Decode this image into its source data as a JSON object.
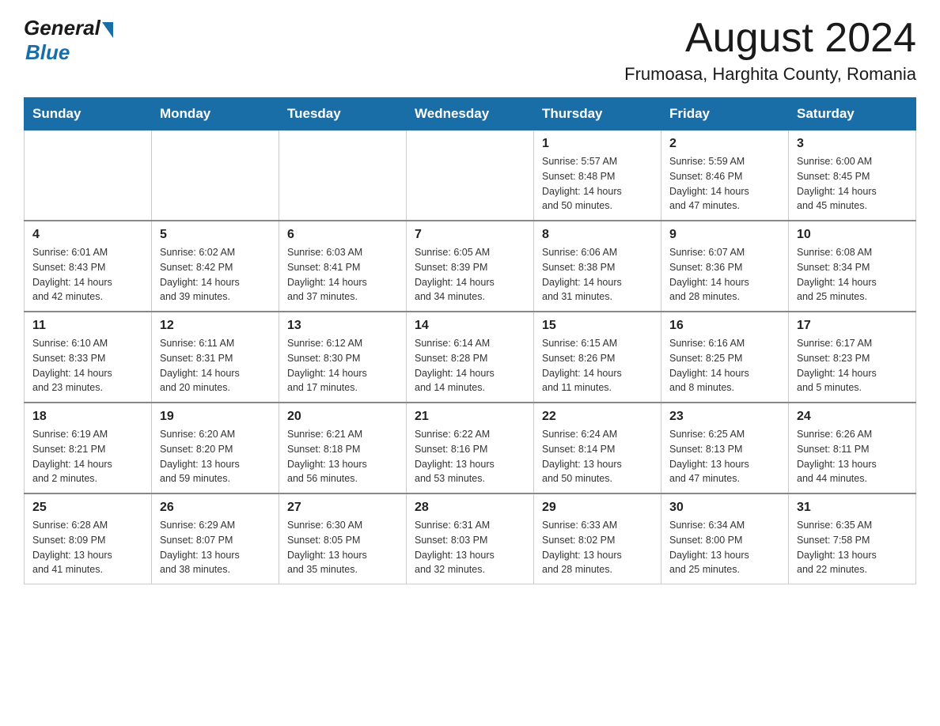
{
  "header": {
    "logo_general": "General",
    "logo_blue": "Blue",
    "month_title": "August 2024",
    "location": "Frumoasa, Harghita County, Romania"
  },
  "weekdays": [
    "Sunday",
    "Monday",
    "Tuesday",
    "Wednesday",
    "Thursday",
    "Friday",
    "Saturday"
  ],
  "weeks": [
    [
      {
        "day": "",
        "info": ""
      },
      {
        "day": "",
        "info": ""
      },
      {
        "day": "",
        "info": ""
      },
      {
        "day": "",
        "info": ""
      },
      {
        "day": "1",
        "info": "Sunrise: 5:57 AM\nSunset: 8:48 PM\nDaylight: 14 hours\nand 50 minutes."
      },
      {
        "day": "2",
        "info": "Sunrise: 5:59 AM\nSunset: 8:46 PM\nDaylight: 14 hours\nand 47 minutes."
      },
      {
        "day": "3",
        "info": "Sunrise: 6:00 AM\nSunset: 8:45 PM\nDaylight: 14 hours\nand 45 minutes."
      }
    ],
    [
      {
        "day": "4",
        "info": "Sunrise: 6:01 AM\nSunset: 8:43 PM\nDaylight: 14 hours\nand 42 minutes."
      },
      {
        "day": "5",
        "info": "Sunrise: 6:02 AM\nSunset: 8:42 PM\nDaylight: 14 hours\nand 39 minutes."
      },
      {
        "day": "6",
        "info": "Sunrise: 6:03 AM\nSunset: 8:41 PM\nDaylight: 14 hours\nand 37 minutes."
      },
      {
        "day": "7",
        "info": "Sunrise: 6:05 AM\nSunset: 8:39 PM\nDaylight: 14 hours\nand 34 minutes."
      },
      {
        "day": "8",
        "info": "Sunrise: 6:06 AM\nSunset: 8:38 PM\nDaylight: 14 hours\nand 31 minutes."
      },
      {
        "day": "9",
        "info": "Sunrise: 6:07 AM\nSunset: 8:36 PM\nDaylight: 14 hours\nand 28 minutes."
      },
      {
        "day": "10",
        "info": "Sunrise: 6:08 AM\nSunset: 8:34 PM\nDaylight: 14 hours\nand 25 minutes."
      }
    ],
    [
      {
        "day": "11",
        "info": "Sunrise: 6:10 AM\nSunset: 8:33 PM\nDaylight: 14 hours\nand 23 minutes."
      },
      {
        "day": "12",
        "info": "Sunrise: 6:11 AM\nSunset: 8:31 PM\nDaylight: 14 hours\nand 20 minutes."
      },
      {
        "day": "13",
        "info": "Sunrise: 6:12 AM\nSunset: 8:30 PM\nDaylight: 14 hours\nand 17 minutes."
      },
      {
        "day": "14",
        "info": "Sunrise: 6:14 AM\nSunset: 8:28 PM\nDaylight: 14 hours\nand 14 minutes."
      },
      {
        "day": "15",
        "info": "Sunrise: 6:15 AM\nSunset: 8:26 PM\nDaylight: 14 hours\nand 11 minutes."
      },
      {
        "day": "16",
        "info": "Sunrise: 6:16 AM\nSunset: 8:25 PM\nDaylight: 14 hours\nand 8 minutes."
      },
      {
        "day": "17",
        "info": "Sunrise: 6:17 AM\nSunset: 8:23 PM\nDaylight: 14 hours\nand 5 minutes."
      }
    ],
    [
      {
        "day": "18",
        "info": "Sunrise: 6:19 AM\nSunset: 8:21 PM\nDaylight: 14 hours\nand 2 minutes."
      },
      {
        "day": "19",
        "info": "Sunrise: 6:20 AM\nSunset: 8:20 PM\nDaylight: 13 hours\nand 59 minutes."
      },
      {
        "day": "20",
        "info": "Sunrise: 6:21 AM\nSunset: 8:18 PM\nDaylight: 13 hours\nand 56 minutes."
      },
      {
        "day": "21",
        "info": "Sunrise: 6:22 AM\nSunset: 8:16 PM\nDaylight: 13 hours\nand 53 minutes."
      },
      {
        "day": "22",
        "info": "Sunrise: 6:24 AM\nSunset: 8:14 PM\nDaylight: 13 hours\nand 50 minutes."
      },
      {
        "day": "23",
        "info": "Sunrise: 6:25 AM\nSunset: 8:13 PM\nDaylight: 13 hours\nand 47 minutes."
      },
      {
        "day": "24",
        "info": "Sunrise: 6:26 AM\nSunset: 8:11 PM\nDaylight: 13 hours\nand 44 minutes."
      }
    ],
    [
      {
        "day": "25",
        "info": "Sunrise: 6:28 AM\nSunset: 8:09 PM\nDaylight: 13 hours\nand 41 minutes."
      },
      {
        "day": "26",
        "info": "Sunrise: 6:29 AM\nSunset: 8:07 PM\nDaylight: 13 hours\nand 38 minutes."
      },
      {
        "day": "27",
        "info": "Sunrise: 6:30 AM\nSunset: 8:05 PM\nDaylight: 13 hours\nand 35 minutes."
      },
      {
        "day": "28",
        "info": "Sunrise: 6:31 AM\nSunset: 8:03 PM\nDaylight: 13 hours\nand 32 minutes."
      },
      {
        "day": "29",
        "info": "Sunrise: 6:33 AM\nSunset: 8:02 PM\nDaylight: 13 hours\nand 28 minutes."
      },
      {
        "day": "30",
        "info": "Sunrise: 6:34 AM\nSunset: 8:00 PM\nDaylight: 13 hours\nand 25 minutes."
      },
      {
        "day": "31",
        "info": "Sunrise: 6:35 AM\nSunset: 7:58 PM\nDaylight: 13 hours\nand 22 minutes."
      }
    ]
  ]
}
